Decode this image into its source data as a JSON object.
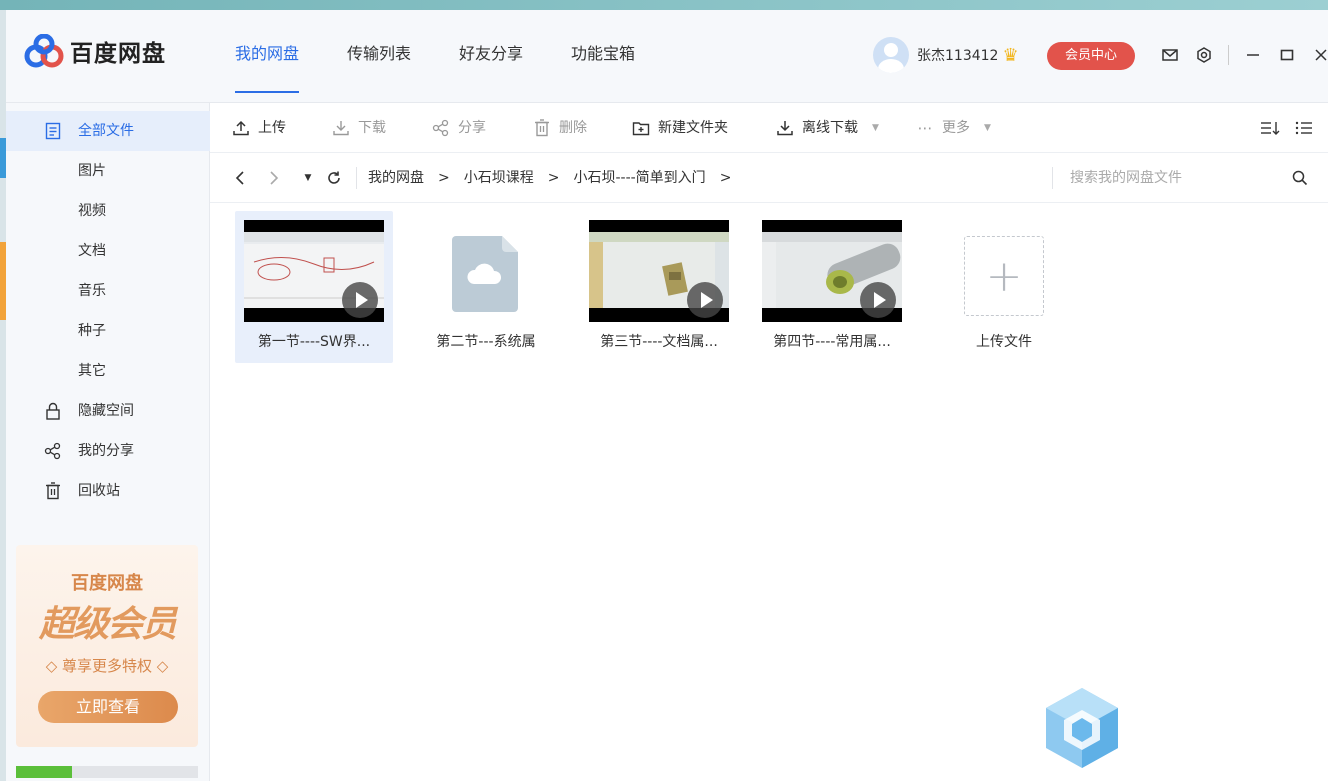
{
  "app": {
    "logo_text": "百度网盘"
  },
  "nav": {
    "tabs": [
      "我的网盘",
      "传输列表",
      "好友分享",
      "功能宝箱"
    ],
    "active_index": 0
  },
  "user": {
    "name": "张杰113412",
    "vip_button": "会员中心"
  },
  "sidebar": {
    "items": [
      {
        "label": "全部文件",
        "icon": "file-list-icon",
        "active": true
      },
      {
        "label": "图片",
        "icon": "",
        "active": false
      },
      {
        "label": "视频",
        "icon": "",
        "active": false
      },
      {
        "label": "文档",
        "icon": "",
        "active": false
      },
      {
        "label": "音乐",
        "icon": "",
        "active": false
      },
      {
        "label": "种子",
        "icon": "",
        "active": false
      },
      {
        "label": "其它",
        "icon": "",
        "active": false
      },
      {
        "label": "隐藏空间",
        "icon": "lock-icon",
        "active": false
      },
      {
        "label": "我的分享",
        "icon": "share-icon",
        "active": false
      },
      {
        "label": "回收站",
        "icon": "trash-icon",
        "active": false
      }
    ],
    "promo": {
      "title": "百度网盘",
      "big": "超级会员",
      "sub": "◇ 尊享更多特权 ◇",
      "button": "立即查看"
    },
    "storage_fraction": 0.31
  },
  "toolbar": {
    "upload": "上传",
    "download": "下载",
    "share": "分享",
    "delete": "删除",
    "new_folder": "新建文件夹",
    "offline_download": "离线下载",
    "more": "更多"
  },
  "path": {
    "crumbs": [
      "我的网盘",
      "小石坝课程",
      "小石坝----简单到入门"
    ],
    "search_placeholder": "搜索我的网盘文件"
  },
  "files": [
    {
      "name": "第一节----SW界...",
      "type": "video",
      "selected": true
    },
    {
      "name": "第二节---系统属",
      "type": "document",
      "selected": false
    },
    {
      "name": "第三节----文档属...",
      "type": "video",
      "selected": false
    },
    {
      "name": "第四节----常用属...",
      "type": "video",
      "selected": false
    },
    {
      "name": "上传文件",
      "type": "upload",
      "selected": false
    }
  ],
  "colors": {
    "accent": "#2b6de5",
    "vip": "#e2534b",
    "promo": "#d7874b",
    "storage": "#5bbf3a"
  }
}
